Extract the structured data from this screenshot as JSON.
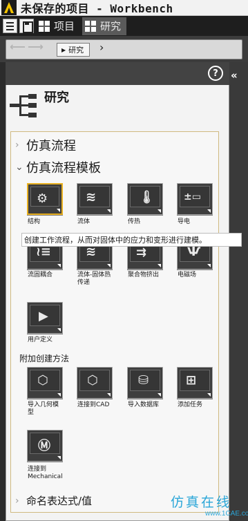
{
  "window": {
    "title": "未保存的项目 - Workbench"
  },
  "toolbar": {
    "tabs": [
      {
        "label": "项目"
      },
      {
        "label": "研究"
      }
    ]
  },
  "nav": {
    "breadcrumb": "研究"
  },
  "panel": {
    "help_glyph": "?",
    "collapse_glyph": "«",
    "title": "研究",
    "sections": {
      "sim_flow": "仿真流程",
      "sim_templates": "仿真流程模板",
      "named_expressions": "命名表达式/值"
    },
    "template_tiles": [
      {
        "label": "结构"
      },
      {
        "label": "流体"
      },
      {
        "label": "传热"
      },
      {
        "label": "导电"
      },
      {
        "label": "流固耦合"
      },
      {
        "label": "流体-固体热\n传递"
      },
      {
        "label": "聚合物挤出"
      },
      {
        "label": "电磁场"
      },
      {
        "label": "用户定义"
      }
    ],
    "additional_heading": "附加创建方法",
    "additional_tiles": [
      {
        "label": "导入几何模\n型"
      },
      {
        "label": "连接到CAD"
      },
      {
        "label": "导入数据库"
      },
      {
        "label": "添加任务"
      },
      {
        "label": "连接到\nMechanical"
      }
    ]
  },
  "tooltip": {
    "text": "创建工作流程，从而对固体中的应力和变形进行建模。"
  },
  "watermark": {
    "main": "仿真在线",
    "sub": "www.1CAE.com"
  },
  "colors": {
    "selection": "#e8b020",
    "group_border": "#d0b980",
    "watermark": "#2aa6d8"
  }
}
